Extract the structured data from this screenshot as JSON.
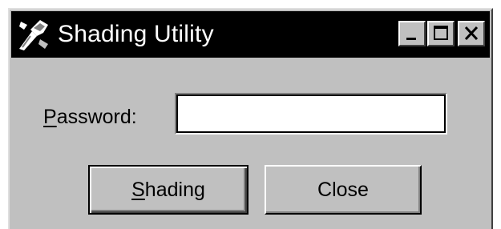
{
  "window": {
    "title": "Shading Utility",
    "icon": "shading-utility-app-icon",
    "controls": {
      "minimize_icon": "minimize-icon",
      "maximize_icon": "maximize-icon",
      "close_icon": "close-icon"
    }
  },
  "form": {
    "password_label_accel": "P",
    "password_label_rest": "assword:",
    "password_value": "",
    "password_placeholder": ""
  },
  "buttons": {
    "shading_accel": "S",
    "shading_rest": "hading",
    "close_label": "Close"
  },
  "colors": {
    "titlebar": "#000000",
    "face": "#c0c0c0",
    "title_text": "#ffffff"
  }
}
